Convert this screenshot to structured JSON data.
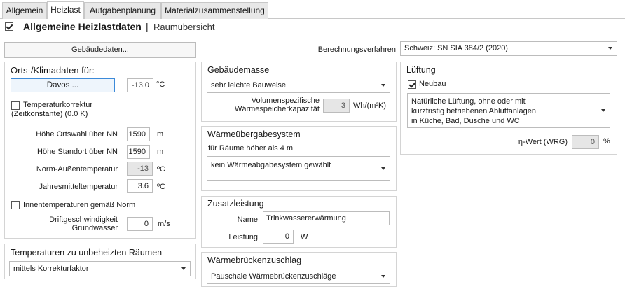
{
  "tabs": [
    "Allgemein",
    "Heizlast",
    "Aufgabenplanung",
    "Materialzusammenstellung"
  ],
  "header": {
    "checked": true,
    "title": "Allgemeine Heizlastdaten",
    "separator": "|",
    "subtitle": "Raumübersicht"
  },
  "buttons": {
    "gebaeudedaten": "Gebäudedaten..."
  },
  "berechnung": {
    "label": "Berechnungsverfahren",
    "value": "Schweiz: SN SIA 384/2 (2020)"
  },
  "orts": {
    "title": "Orts-/Klimadaten für:",
    "city_button": "Davos ...",
    "temp_value": "-13.0",
    "temp_unit": "°C",
    "korrektur_checked": false,
    "korrektur_label_1": "Temperaturkorrektur",
    "korrektur_label_2": "(Zeitkonstante) (0.0 K)",
    "rows": [
      {
        "label": "Höhe Ortswahl über NN",
        "value": "1590",
        "unit": "m"
      },
      {
        "label": "Höhe Standort über NN",
        "value": "1590",
        "unit": "m"
      },
      {
        "label": "Norm-Außentemperatur",
        "value": "-13",
        "unit": "ºC"
      },
      {
        "label": "Jahresmitteltemperatur",
        "value": "3.6",
        "unit": "ºC"
      }
    ],
    "innen_checked": false,
    "innen_label": "Innentemperaturen gemäß Norm",
    "drift_label_1": "Driftgeschwindigkeit",
    "drift_label_2": "Grundwasser",
    "drift_value": "0",
    "drift_unit": "m/s"
  },
  "unbeheizt": {
    "title": "Temperaturen zu unbeheizten Räumen",
    "value": "mittels Korrekturfaktor"
  },
  "masse": {
    "title": "Gebäudemasse",
    "value": "sehr leichte Bauweise",
    "label_1": "Volumenspezifische",
    "label_2": "Wärmespeicherkapazität",
    "kap_value": "3",
    "kap_unit": "Wh/(m³K)"
  },
  "uebergabe": {
    "title": "Wärmeübergabesystem",
    "sub": "für Räume höher als 4 m",
    "value": "kein Wärmeabgabesystem gewählt"
  },
  "zusatz": {
    "title": "Zusatzleistung",
    "name_label": "Name",
    "name_value": "Trinkwassererwärmung",
    "leistung_label": "Leistung",
    "leistung_value": "0",
    "leistung_unit": "W"
  },
  "bruecke": {
    "title": "Wärmebrückenzuschlag",
    "value": "Pauschale Wärmebrückenzuschläge"
  },
  "lueftung": {
    "title": "Lüftung",
    "neubau_checked": true,
    "neubau_label": "Neubau",
    "desc_1": "Natürliche Lüftung, ohne oder mit",
    "desc_2": "kurzfristig betriebenen Abluftanlagen",
    "desc_3": "in Küche, Bad, Dusche und WC",
    "eta_label": "η-Wert (WRG)",
    "eta_value": "0",
    "eta_unit": "%"
  }
}
